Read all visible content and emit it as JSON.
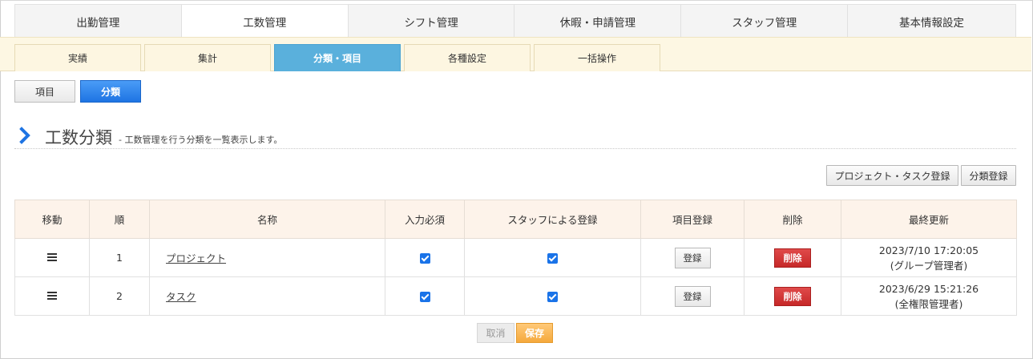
{
  "main_tabs": [
    "出勤管理",
    "工数管理",
    "シフト管理",
    "休暇・申請管理",
    "スタッフ管理",
    "基本情報設定"
  ],
  "sub_tabs": [
    "実績",
    "集計",
    "分類・項目",
    "各種設定",
    "一括操作"
  ],
  "toggle": {
    "item": "項目",
    "category": "分類"
  },
  "section": {
    "title": "工数分類",
    "description": "- 工数管理を行う分類を一覧表示します。"
  },
  "buttons": {
    "project_task_register": "プロジェクト・タスク登録",
    "category_register": "分類登録",
    "cancel": "取消",
    "save": "保存"
  },
  "table": {
    "headers": [
      "移動",
      "順",
      "名称",
      "入力必須",
      "スタッフによる登録",
      "項目登録",
      "削除",
      "最終更新"
    ],
    "rows": [
      {
        "order": "1",
        "name": "プロジェクト",
        "register": "登録",
        "delete": "削除",
        "updated_date": "2023/7/10 17:20:05",
        "updated_by": "(グループ管理者)"
      },
      {
        "order": "2",
        "name": "タスク",
        "register": "登録",
        "delete": "削除",
        "updated_date": "2023/6/29 15:21:26",
        "updated_by": "(全権限管理者)"
      }
    ]
  },
  "colors": {
    "accent_blue": "#5ab0dc",
    "primary": "#1e74e3",
    "danger": "#c62828",
    "save": "#f5a93c"
  },
  "icons": {
    "section": "chevron-right-icon",
    "move": "drag-handle-icon",
    "check": "checkbox-checked-icon"
  }
}
